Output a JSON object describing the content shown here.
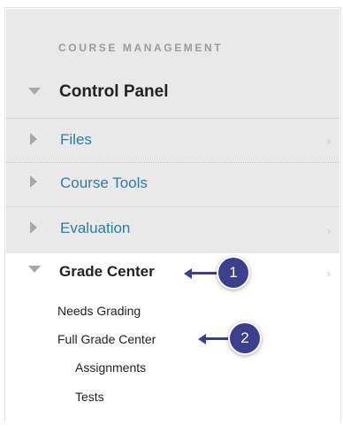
{
  "section_title": "COURSE MANAGEMENT",
  "nav": {
    "control_panel": "Control Panel",
    "files": "Files",
    "course_tools": "Course Tools",
    "evaluation": "Evaluation",
    "grade_center": "Grade Center",
    "chevron": "›"
  },
  "grade_center_items": {
    "needs_grading": "Needs Grading",
    "full_grade_center": "Full Grade Center",
    "assignments": "Assignments",
    "tests": "Tests"
  },
  "callouts": {
    "one": "1",
    "two": "2"
  },
  "colors": {
    "link": "#2c7ea3",
    "callout": "#3b3f8e",
    "panel_bg": "#e9e9e9"
  }
}
